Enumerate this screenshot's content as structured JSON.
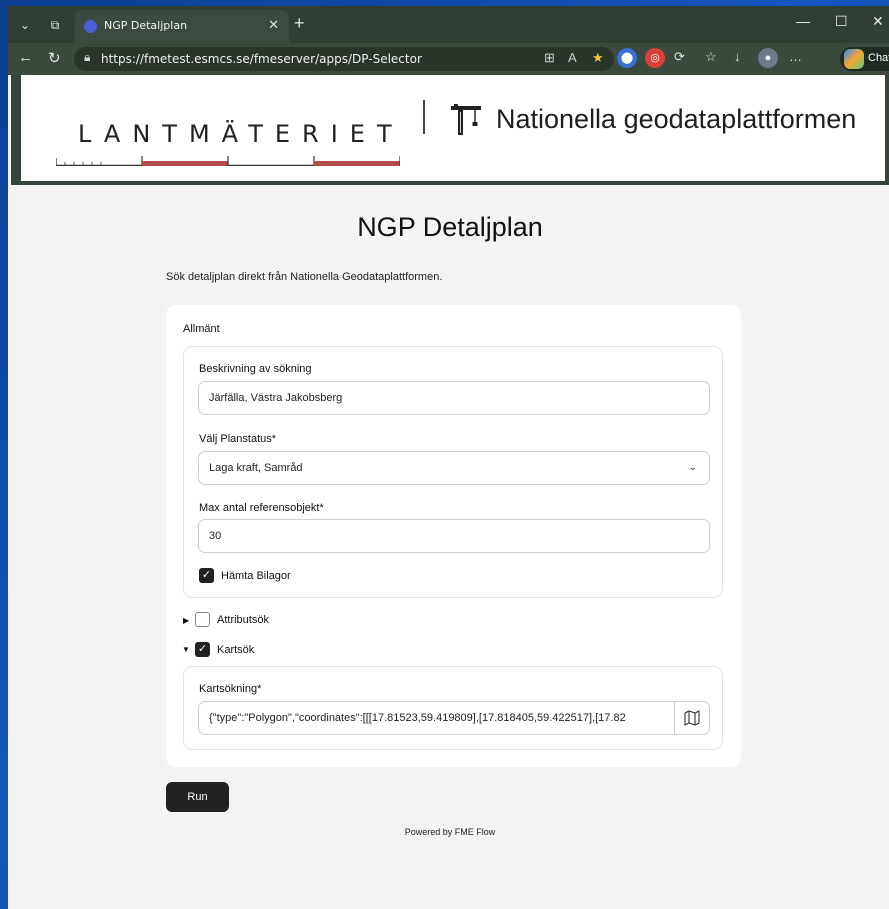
{
  "browser": {
    "tab_title": "NGP Detaljplan",
    "url": "https://fmetest.esmcs.se/fmeserver/apps/DP-Selector",
    "chat_label": "Chat"
  },
  "banner": {
    "lm_logo_text": "LANTMÄTERIET",
    "ngp_title": "Nationella geodataplattformen"
  },
  "page": {
    "title": "NGP Detaljplan",
    "description": "Sök detaljplan direkt från Nationella Geodataplattformen."
  },
  "form": {
    "section_general": "Allmänt",
    "search_desc_label": "Beskrivning av sökning",
    "search_desc_value": "Järfälla, Västra Jakobsberg",
    "planstatus_label": "Välj Planstatus*",
    "planstatus_value": "Laga kraft,  Samråd",
    "max_ref_label": "Max antal referensobjekt*",
    "max_ref_value": "30",
    "fetch_attachments_label": "Hämta Bilagor",
    "fetch_attachments_checked": true,
    "attribute_search_label": "Attributsök",
    "attribute_search_checked": false,
    "map_search_label": "Kartsök",
    "map_search_checked": true,
    "map_search_field_label": "Kartsökning*",
    "map_search_value": "{\"type\":\"Polygon\",\"coordinates\":[[[17.81523,59.419809],[17.818405,59.422517],[17.82"
  },
  "actions": {
    "run_label": "Run"
  },
  "footer": {
    "powered_by": "Powered by FME Flow"
  },
  "colors": {
    "scale_red": "#b54a4a",
    "banner_border": "#35473a",
    "run_button": "#222222"
  }
}
